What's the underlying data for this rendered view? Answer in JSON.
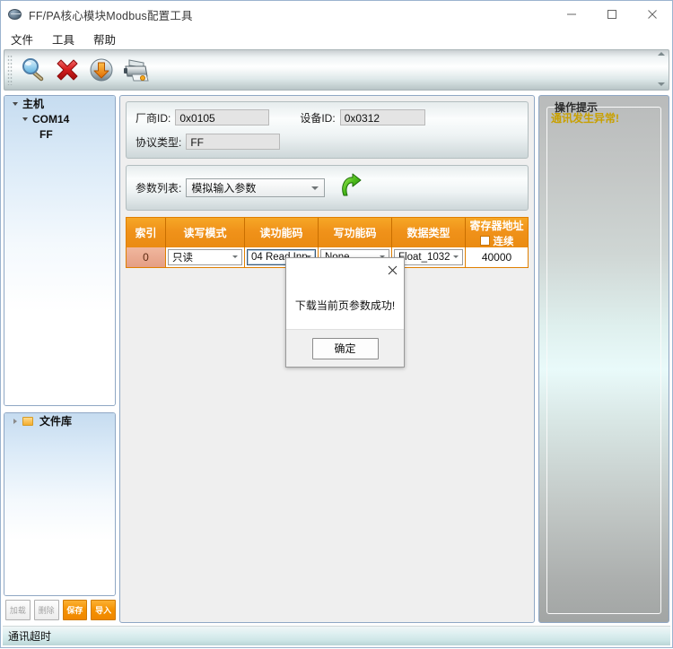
{
  "window": {
    "title": "FF/PA核心模块Modbus配置工具",
    "icon": "globe-icon",
    "minimize": "–",
    "maximize": "□",
    "close": "✕"
  },
  "menu": {
    "items": [
      {
        "label": "文件",
        "name": "menu-file"
      },
      {
        "label": "工具",
        "name": "menu-tools"
      },
      {
        "label": "帮助",
        "name": "menu-help"
      }
    ]
  },
  "toolbar": {
    "buttons": [
      {
        "icon": "search-icon",
        "name": "toolbar-search"
      },
      {
        "icon": "delete-x-icon",
        "name": "toolbar-delete"
      },
      {
        "icon": "download-icon",
        "name": "toolbar-download"
      },
      {
        "icon": "printer-icon",
        "name": "toolbar-print"
      }
    ]
  },
  "tree": {
    "root_label": "主机",
    "child_label": "COM14",
    "leaf_label": "FF"
  },
  "filelib": {
    "label": "文件库",
    "icon": "folder-icon"
  },
  "filebuttons": [
    {
      "label": "加载",
      "name": "load-button",
      "state": "disabled"
    },
    {
      "label": "删除",
      "name": "delete-button",
      "state": "disabled"
    },
    {
      "label": "保存",
      "name": "save-button",
      "state": "active"
    },
    {
      "label": "导入",
      "name": "import-button",
      "state": "active"
    }
  ],
  "form": {
    "vendor_id_label": "厂商ID:",
    "vendor_id_value": "0x0105",
    "device_id_label": "设备ID:",
    "device_id_value": "0x0312",
    "protocol_label": "协议类型:",
    "protocol_value": "FF"
  },
  "paramlist": {
    "label": "参数列表:",
    "selected": "模拟输入参数",
    "download_icon": "download-arrow-icon"
  },
  "table": {
    "headers": {
      "index": "索引",
      "rw_mode": "读写模式",
      "read_code": "读功能码",
      "write_code": "写功能码",
      "data_type": "数据类型",
      "register_addr": "寄存器地址",
      "continuous": "连续"
    },
    "rows": [
      {
        "index": "0",
        "rw_mode": "只读",
        "read_code": "04 Read Inp",
        "write_code": "None",
        "data_type": "Float_1032",
        "register_addr": "40000"
      }
    ]
  },
  "hintpanel": {
    "title": "操作提示",
    "message": "通讯发生异常!",
    "message_color": "#c8a000"
  },
  "statusbar": {
    "text": "通讯超时"
  },
  "dialog": {
    "message": "下载当前页参数成功!",
    "ok_label": "确定",
    "close_label": "✕"
  }
}
